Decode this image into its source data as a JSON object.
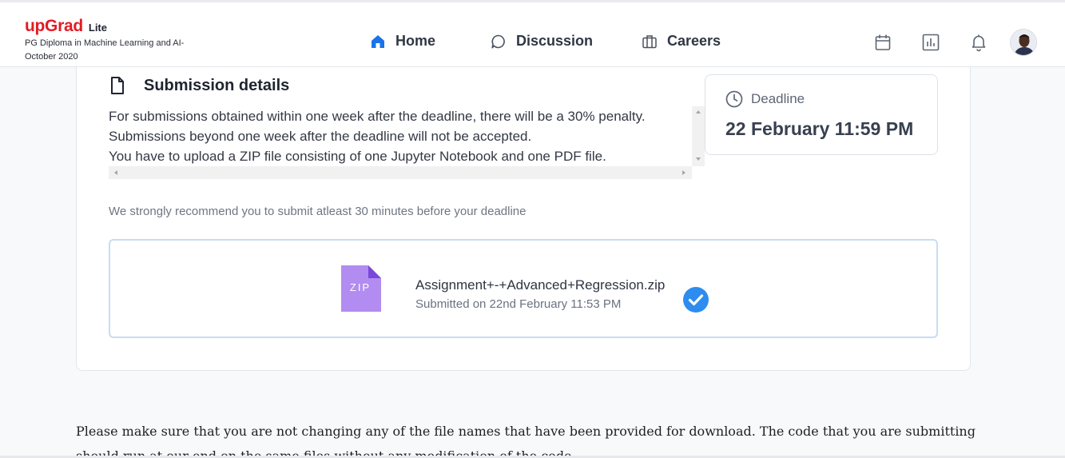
{
  "header": {
    "brand": "upGrad",
    "brand_suffix": "Lite",
    "program": "PG Diploma in Machine Learning and AI- October 2020",
    "nav": [
      {
        "label": "Home",
        "icon": "home-icon",
        "active": true
      },
      {
        "label": "Discussion",
        "icon": "chat-bubble-icon"
      },
      {
        "label": "Careers",
        "icon": "briefcase-icon"
      }
    ],
    "right_icons": [
      "calendar-icon",
      "bar-chart-icon",
      "bell-icon",
      "avatar"
    ]
  },
  "submission": {
    "title": "Submission details",
    "details": [
      "For submissions obtained within one week after the deadline, there will be a 30% penalty.",
      "Submissions beyond one week after the deadline will not be accepted.",
      "You have to upload a ZIP file consisting of one Jupyter Notebook and one PDF file."
    ],
    "deadline_label": "Deadline",
    "deadline_value": "22 February 11:59 PM",
    "recommend": "We strongly recommend you to submit atleast 30 minutes before your deadline",
    "file": {
      "type_label": "ZIP",
      "name": "Assignment+-+Advanced+Regression.zip",
      "submitted": "Submitted on 22nd February 11:53 PM"
    }
  },
  "note": {
    "line1": "Please make sure that you are not changing any of the file names that have been provided for download. The code that you are submitting",
    "line2": "should run at our end on the same files without any modification of the code."
  },
  "colors": {
    "brand_red": "#e31b23",
    "active_nav": "#1a73e8",
    "zip_purple": "#b28cf0",
    "check_blue": "#2d8cf0"
  }
}
